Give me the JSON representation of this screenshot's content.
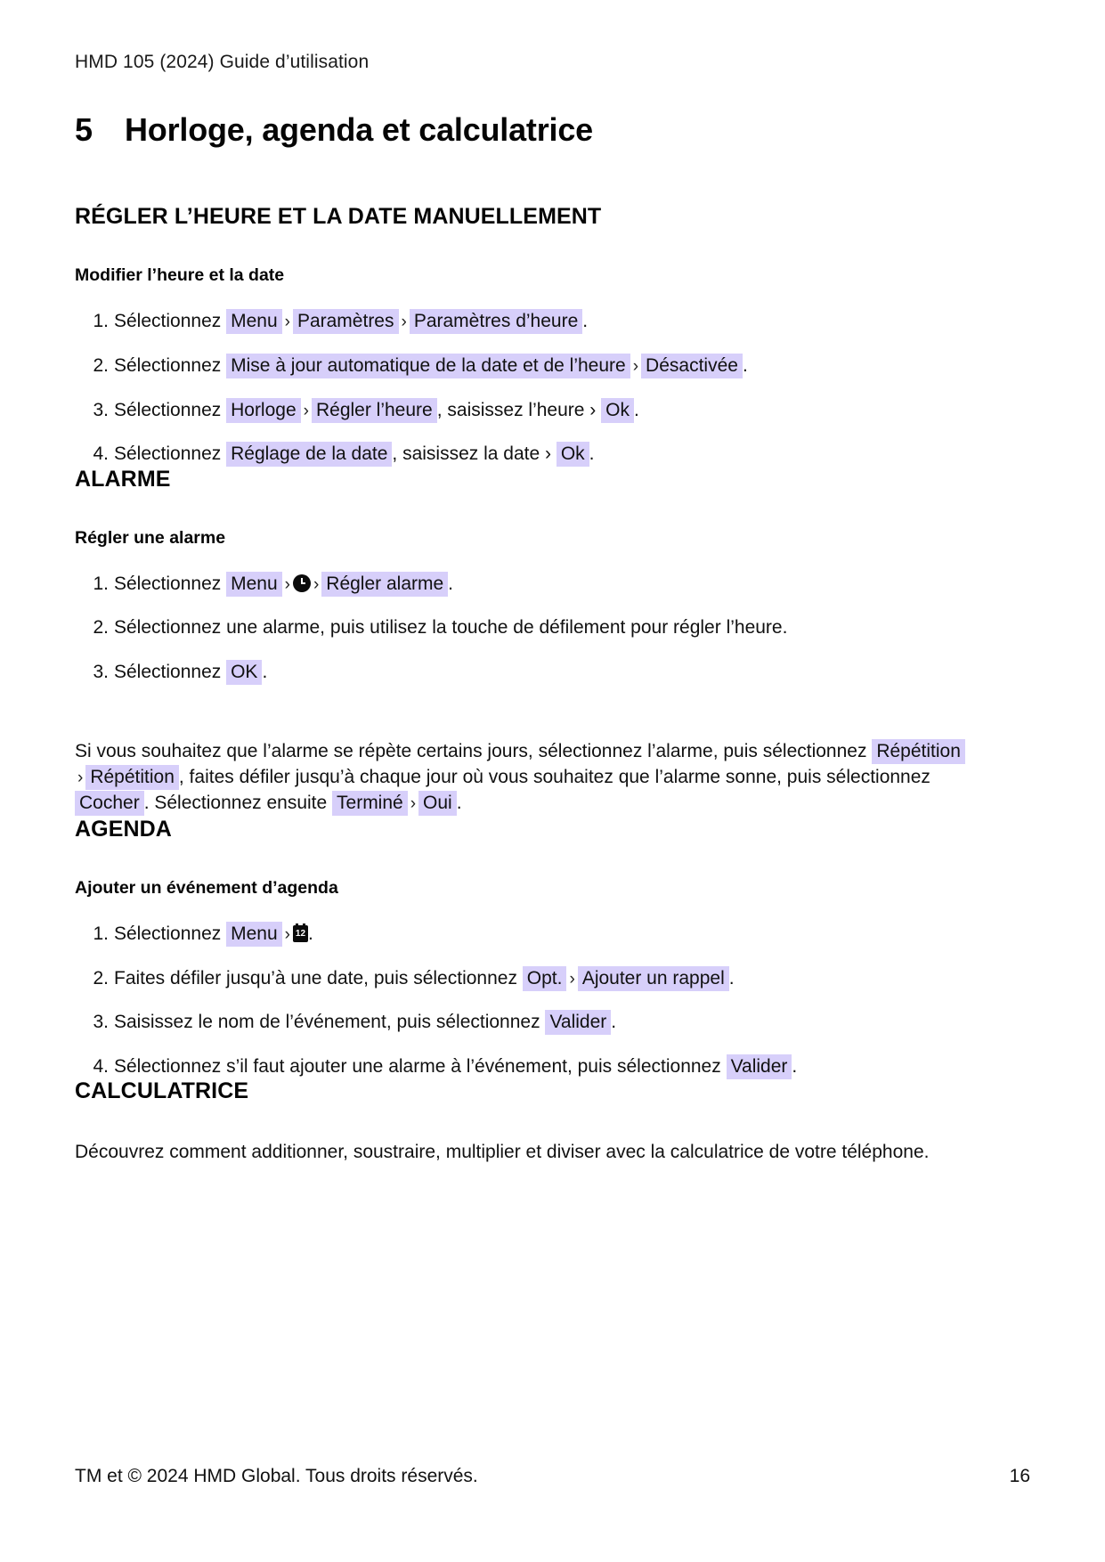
{
  "document": {
    "running_header": "HMD 105 (2024) Guide d’utilisation",
    "chapter_number": "5",
    "chapter_title": "Horloge, agenda et calculatrice"
  },
  "colors": {
    "ui_highlight": "#d7cffa",
    "text": "#111111",
    "page_background": "#ffffff"
  },
  "sections": {
    "time_date": {
      "heading": "RÉGLER L’HEURE ET LA DATE MANUELLEMENT",
      "subheading": "Modifier l’heure et la date",
      "steps": [
        {
          "lead": "Sélectionnez",
          "chip1": "Menu",
          "sep1": "›",
          "chip2": "Paramètres",
          "sep2": "›",
          "chip3": "Paramètres d’heure",
          "tail": "."
        },
        {
          "lead": "Sélectionnez",
          "chip1": "Mise à jour automatique de la date et de l’heure",
          "sep1": "›",
          "chip2": "Désactivée",
          "tail": "."
        },
        {
          "lead": "Sélectionnez",
          "chip1": "Horloge",
          "sep1": "›",
          "chip2": "Régler l’heure",
          "mid": ", saisissez l’heure ›",
          "chip3": "Ok",
          "tail": "."
        },
        {
          "lead": "Sélectionnez",
          "chip1": "Réglage de la date",
          "mid": ", saisissez la date ›",
          "chip2": "Ok",
          "tail": "."
        }
      ]
    },
    "alarm": {
      "heading": "ALARME",
      "subheading": "Régler une alarme",
      "steps": [
        {
          "lead": "Sélectionnez",
          "chip1": "Menu",
          "sep1": "›",
          "icon": "clock-icon",
          "sep2": "›",
          "chip2": "Régler alarme",
          "tail": "."
        },
        {
          "text": "Sélectionnez une alarme, puis utilisez la touche de défilement pour régler l’heure."
        },
        {
          "lead": "Sélectionnez",
          "chip1": "OK",
          "tail": "."
        }
      ],
      "paragraph": {
        "part1": "Si vous souhaitez que l’alarme se répète certains jours, sélectionnez l’alarme, puis sélectionnez",
        "chip1": "Répétition",
        "sep1": "›",
        "chip2": "Répétition",
        "part2": ", faites défiler jusqu’à chaque jour où vous souhaitez que l’alarme sonne, puis sélectionnez",
        "chip3": "Cocher",
        "part3": ". Sélectionnez ensuite",
        "chip4": "Terminé",
        "sep2": "›",
        "chip5": "Oui",
        "tail": "."
      }
    },
    "agenda": {
      "heading": "AGENDA",
      "subheading": "Ajouter un événement d’agenda",
      "steps": [
        {
          "lead": "Sélectionnez",
          "chip1": "Menu",
          "sep1": "›",
          "icon": "calendar-icon",
          "icon_label": "12",
          "tail": "."
        },
        {
          "lead": "Faites défiler jusqu’à une date, puis sélectionnez",
          "chip1": "Opt.",
          "sep1": "›",
          "chip2": "Ajouter un rappel",
          "tail": "."
        },
        {
          "lead": "Saisissez le nom de l’événement, puis sélectionnez",
          "chip1": "Valider",
          "tail": "."
        },
        {
          "lead": "Sélectionnez s’il faut ajouter une alarme à l’événement, puis sélectionnez",
          "chip1": "Valider",
          "tail": "."
        }
      ]
    },
    "calculator": {
      "heading": "CALCULATRICE",
      "paragraph": "Découvrez comment additionner, soustraire, multiplier et diviser avec la calculatrice de votre téléphone."
    }
  },
  "footer": {
    "copyright": "TM et © 2024 HMD Global. Tous droits réservés.",
    "page_number": "16"
  }
}
